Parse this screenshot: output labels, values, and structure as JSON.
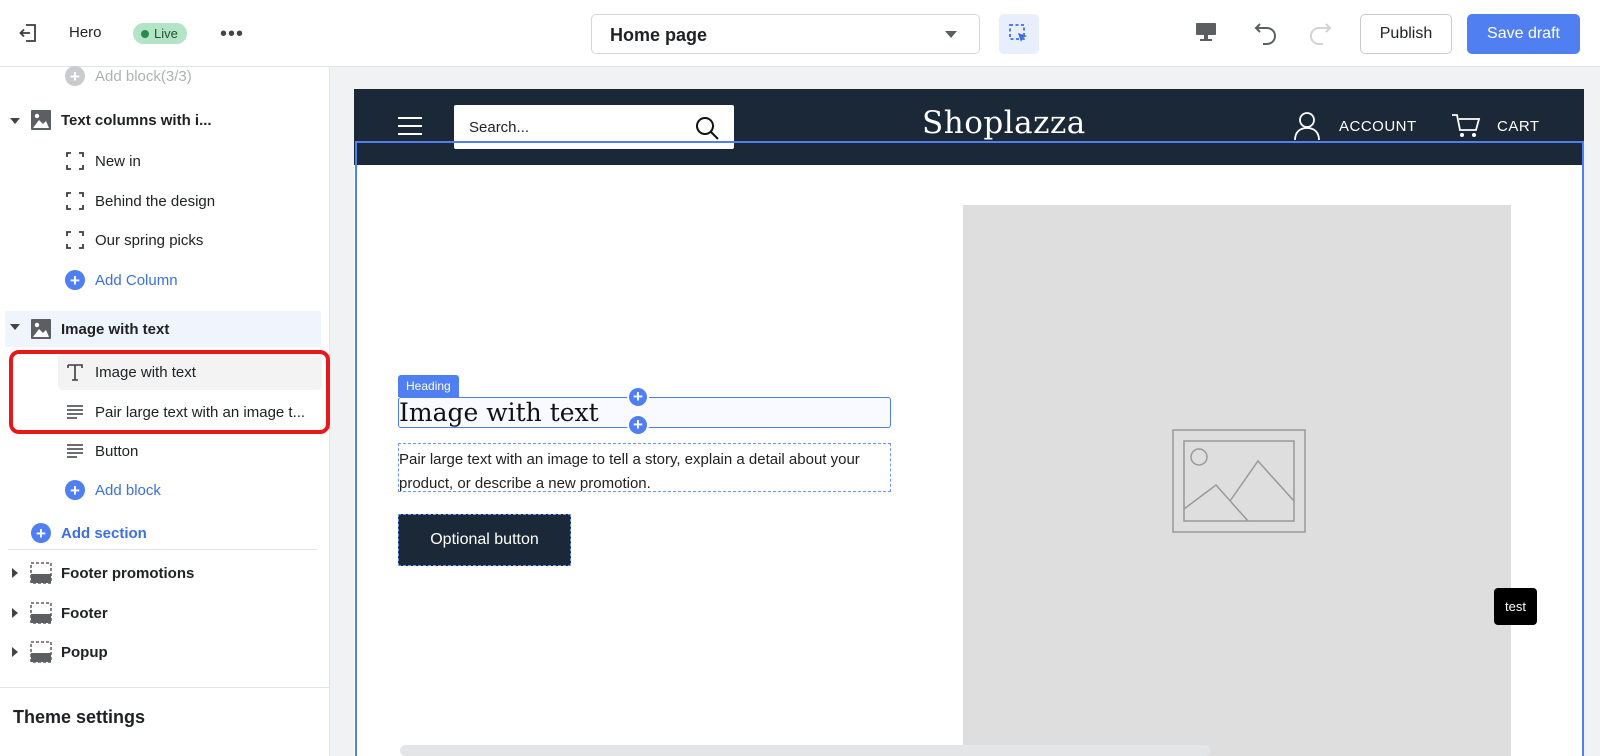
{
  "topbar": {
    "theme_name": "Hero",
    "status_badge": "Live",
    "more_label": "•••",
    "page_select_value": "Home page",
    "publish_label": "Publish",
    "save_label": "Save draft"
  },
  "sidebar": {
    "add_block_top": "Add block(3/3)",
    "text_columns_section": "Text columns with i...",
    "columns": [
      "New in",
      "Behind the design",
      "Our spring picks"
    ],
    "add_column": "Add Column",
    "image_with_text_section": "Image with text",
    "blocks": [
      "Image with text",
      "Pair large text with an image t...",
      "Button"
    ],
    "add_block": "Add block",
    "add_section": "Add section",
    "footer_sections": [
      "Footer promotions",
      "Footer",
      "Popup"
    ],
    "theme_settings": "Theme settings"
  },
  "preview": {
    "search_placeholder": "Search...",
    "logo": "Shoplazza",
    "account_label": "ACCOUNT",
    "cart_label": "CART",
    "heading_tag": "Heading",
    "heading": "Image with text",
    "paragraph": "Pair large text with an image to tell a story, explain a detail about your product, or describe a new promotion.",
    "button": "Optional button",
    "test_button": "test"
  },
  "colors": {
    "accent": "#4f7ff0",
    "store_header_bg": "#1b2837",
    "highlight_red": "#e5191b",
    "live_badge_bg": "#b4e4c6"
  }
}
